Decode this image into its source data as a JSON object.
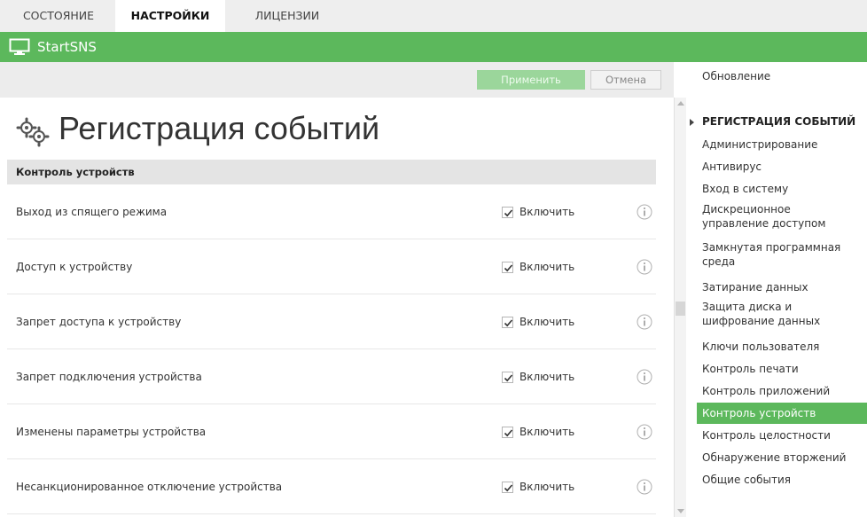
{
  "tabs": [
    {
      "label": "СОСТОЯНИЕ",
      "active": false
    },
    {
      "label": "НАСТРОЙКИ",
      "active": true
    },
    {
      "label": "ЛИЦЕНЗИИ",
      "active": false
    }
  ],
  "app": {
    "title": "StartSNS",
    "icon": "monitor-icon",
    "accent_color": "#5cb85c"
  },
  "toolbar": {
    "apply_label": "Применить",
    "cancel_label": "Отмена"
  },
  "page": {
    "title": "Регистрация событий",
    "icon": "gears-icon"
  },
  "section": {
    "title": "Контроль устройств"
  },
  "rows": [
    {
      "label": "Выход из спящего режима",
      "enable_label": "Включить",
      "checked": true
    },
    {
      "label": "Доступ к устройству",
      "enable_label": "Включить",
      "checked": true
    },
    {
      "label": "Запрет доступа к устройству",
      "enable_label": "Включить",
      "checked": true
    },
    {
      "label": "Запрет подключения устройства",
      "enable_label": "Включить",
      "checked": true
    },
    {
      "label": "Изменены параметры устройства",
      "enable_label": "Включить",
      "checked": true
    },
    {
      "label": "Несанкционированное отключение устройства",
      "enable_label": "Включить",
      "checked": true
    }
  ],
  "sidebar": {
    "top_item": "Обновление",
    "group_title": "РЕГИСТРАЦИЯ СОБЫТИЙ",
    "items": [
      {
        "lines": [
          "Администрирование"
        ],
        "selected": false
      },
      {
        "lines": [
          "Антивирус"
        ],
        "selected": false
      },
      {
        "lines": [
          "Вход в систему"
        ],
        "selected": false
      },
      {
        "lines": [
          "Дискреционное",
          "управление доступом"
        ],
        "selected": false
      },
      {
        "lines": [
          "Замкнутая программная",
          "среда"
        ],
        "selected": false
      },
      {
        "lines": [
          "Затирание данных"
        ],
        "selected": false
      },
      {
        "lines": [
          "Защита диска и",
          "шифрование данных"
        ],
        "selected": false
      },
      {
        "lines": [
          "Ключи пользователя"
        ],
        "selected": false
      },
      {
        "lines": [
          "Контроль печати"
        ],
        "selected": false
      },
      {
        "lines": [
          "Контроль приложений"
        ],
        "selected": false
      },
      {
        "lines": [
          "Контроль устройств"
        ],
        "selected": true
      },
      {
        "lines": [
          "Контроль целостности"
        ],
        "selected": false
      },
      {
        "lines": [
          "Обнаружение вторжений"
        ],
        "selected": false
      },
      {
        "lines": [
          "Общие события"
        ],
        "selected": false
      }
    ]
  }
}
